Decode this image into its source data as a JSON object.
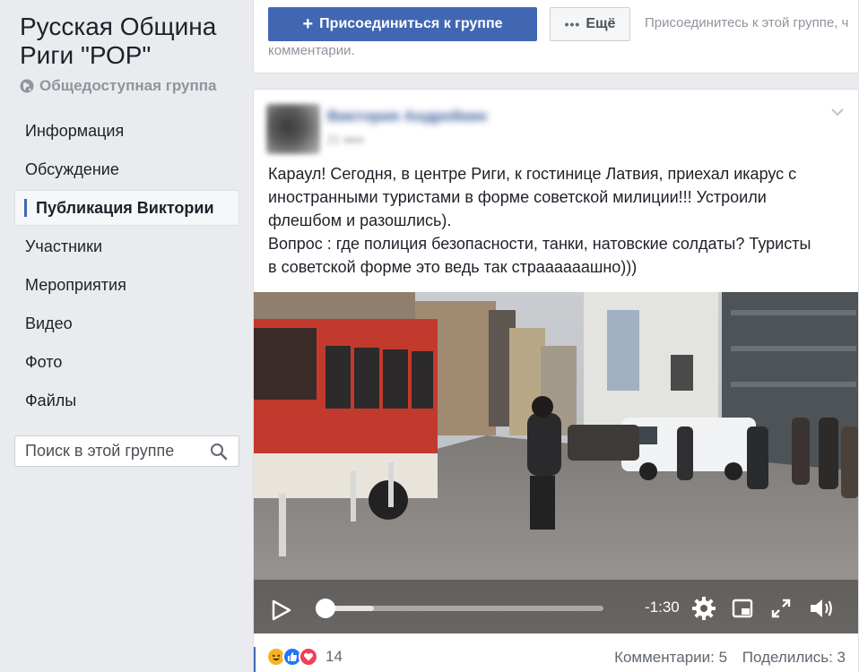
{
  "group": {
    "title": "Русская Община Риги \"РОР\"",
    "privacy": "Общедоступная группа"
  },
  "nav": {
    "items": [
      {
        "label": "Информация",
        "active": false
      },
      {
        "label": "Обсуждение",
        "active": false
      },
      {
        "label": "Публикация Виктории",
        "active": true
      },
      {
        "label": "Участники",
        "active": false
      },
      {
        "label": "Мероприятия",
        "active": false
      },
      {
        "label": "Видео",
        "active": false
      },
      {
        "label": "Фото",
        "active": false
      },
      {
        "label": "Файлы",
        "active": false
      }
    ]
  },
  "search": {
    "placeholder": "Поиск в этой группе"
  },
  "header": {
    "join_label": "Присоединиться к группе",
    "more_label": "Ещё",
    "join_hint": "Присоединитесь к этой группе, ч",
    "join_hint_2": "комментарии."
  },
  "post": {
    "author": "Виктория Андрейкин",
    "time": "21 мин",
    "text_lines": [
      "Караул! Сегодня, в центре Риги, к гостинице Латвия, приехал икарус с",
      "иностранными туристами в форме советской милиции!!! Устроили",
      "флешбом и разошлись).",
      "Вопрос : где полиция безопасности, танки, натовские солдаты? Туристы",
      "в советской форме это ведь так страааааашно)))"
    ],
    "video": {
      "time_remaining": "-1:30",
      "progress": 0.02,
      "buffered": 0.19
    },
    "reactions": {
      "types": [
        "haha",
        "like",
        "love"
      ],
      "count": "14"
    },
    "comments": "Комментарии: 5",
    "shares": "Поделились: 3"
  },
  "colors": {
    "accent": "#4267b2",
    "background": "#e9ebee",
    "muted": "#90949c"
  }
}
